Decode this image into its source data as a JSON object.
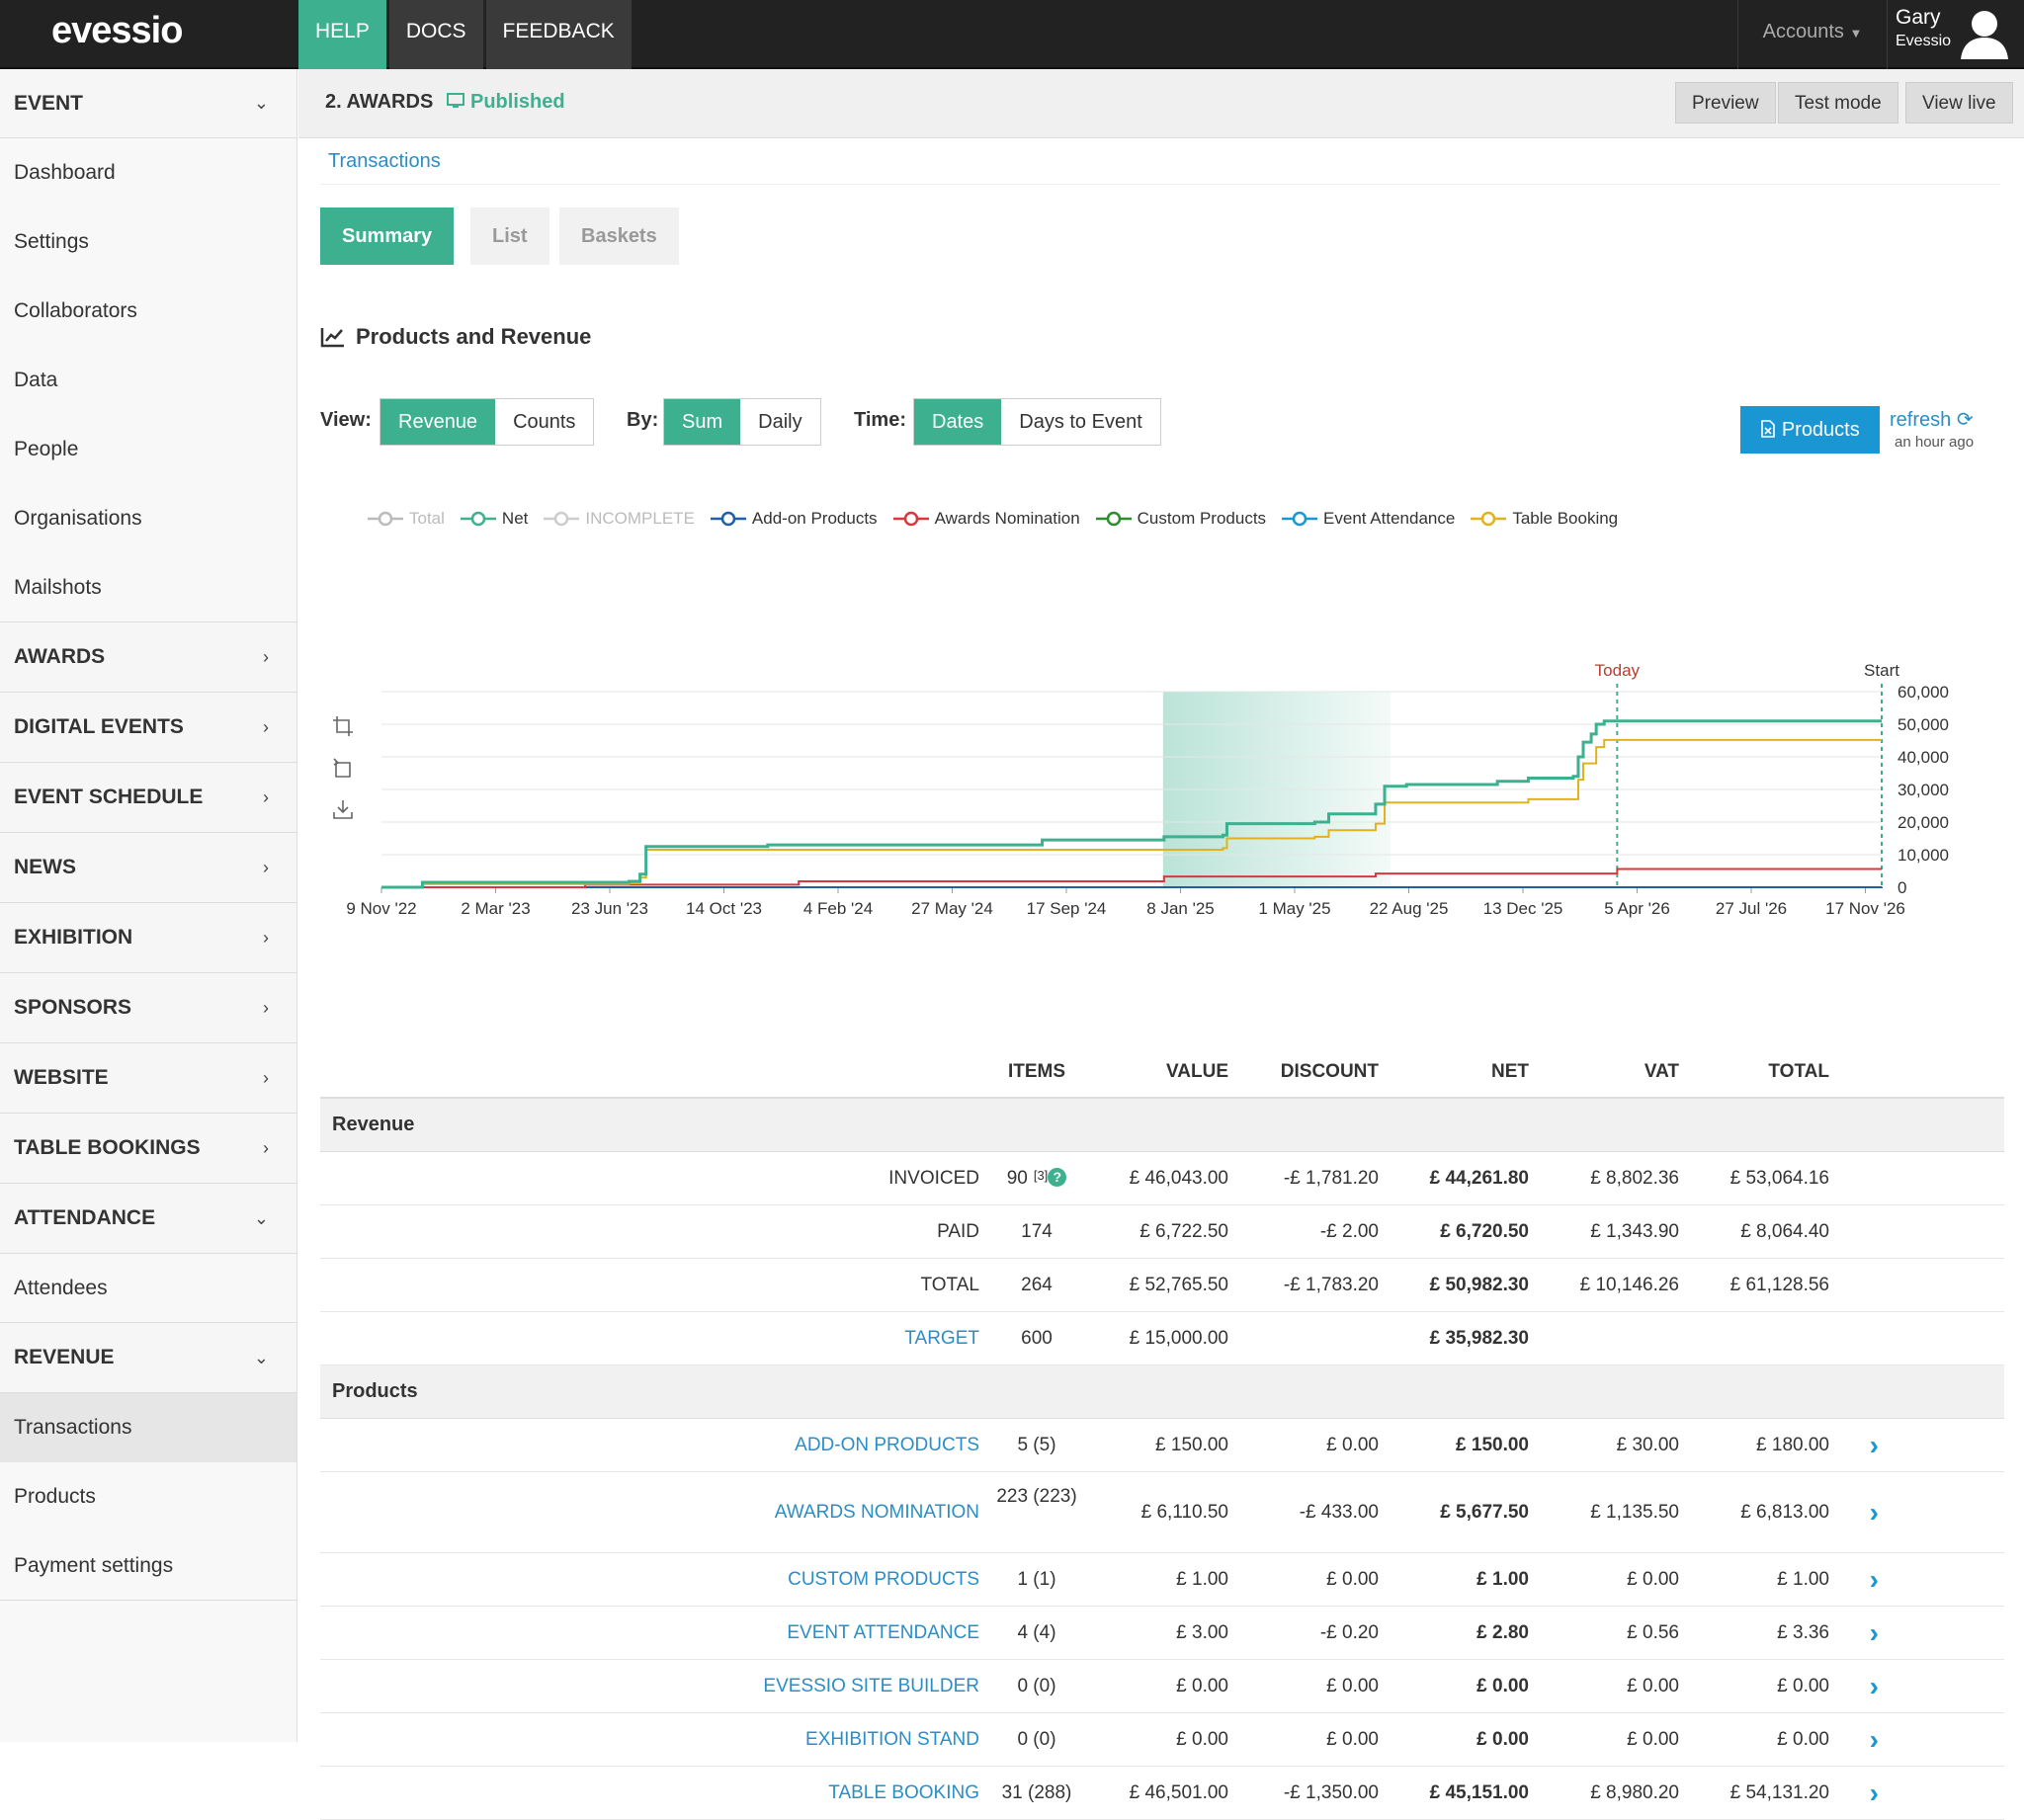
{
  "topbar": {
    "logo": "evessio",
    "nav": [
      "HELP",
      "DOCS",
      "FEEDBACK"
    ],
    "accounts": "Accounts",
    "user_name": "Gary",
    "user_org": "Evessio"
  },
  "sidebar": {
    "event": "EVENT",
    "event_items": [
      "Dashboard",
      "Settings",
      "Collaborators",
      "Data",
      "People",
      "Organisations",
      "Mailshots"
    ],
    "sections": [
      "AWARDS",
      "DIGITAL EVENTS",
      "EVENT SCHEDULE",
      "NEWS",
      "EXHIBITION",
      "SPONSORS",
      "WEBSITE",
      "TABLE BOOKINGS"
    ],
    "attendance": "ATTENDANCE",
    "attendance_items": [
      "Attendees"
    ],
    "revenue": "REVENUE",
    "revenue_items": [
      "Transactions",
      "Products",
      "Payment settings"
    ]
  },
  "page": {
    "title": "2. AWARDS",
    "status": "Published",
    "buttons": [
      "Preview",
      "Test mode",
      "View live"
    ],
    "breadcrumb": "Transactions",
    "tabs": [
      "Summary",
      "List",
      "Baskets"
    ]
  },
  "section_title": "Products and Revenue",
  "controls": {
    "view_label": "View:",
    "view_options": [
      "Revenue",
      "Counts"
    ],
    "by_label": "By:",
    "by_options": [
      "Sum",
      "Daily"
    ],
    "time_label": "Time:",
    "time_options": [
      "Dates",
      "Days to Event"
    ],
    "products_button": "Products",
    "refresh": "refresh",
    "refreshed": "an hour ago"
  },
  "chart_data": {
    "type": "line",
    "x_ticks": [
      "9 Nov '22",
      "2 Mar '23",
      "23 Jun '23",
      "14 Oct '23",
      "4 Feb '24",
      "27 May '24",
      "17 Sep '24",
      "8 Jan '25",
      "1 May '25",
      "22 Aug '25",
      "13 Dec '25",
      "5 Apr '26",
      "27 Jul '26",
      "17 Nov '26"
    ],
    "y_ticks": [
      "60,000",
      "50,000",
      "40,000",
      "30,000",
      "20,000",
      "10,000",
      "0"
    ],
    "ylim": [
      0,
      60000
    ],
    "xlim": [
      "2022-11-09",
      "2026-12-21"
    ],
    "markers": [
      {
        "label": "Today",
        "date": "2026-03-31",
        "color": "#c0392b"
      },
      {
        "label": "Start",
        "date": "2026-12-21",
        "color": "#333333"
      }
    ],
    "highlight": {
      "from": "2024-12-31",
      "to": "2025-08-16"
    },
    "legend": [
      {
        "name": "Total",
        "color": "#bbbbbb",
        "dim": true
      },
      {
        "name": "Net",
        "color": "#3cb08f",
        "dim": false
      },
      {
        "name": "INCOMPLETE",
        "color": "#cccccc",
        "dim": true
      },
      {
        "name": "Add-on Products",
        "color": "#1f5fa8",
        "dim": false
      },
      {
        "name": "Awards Nomination",
        "color": "#d9363e",
        "dim": false
      },
      {
        "name": "Custom Products",
        "color": "#2e8b2e",
        "dim": false
      },
      {
        "name": "Event Attendance",
        "color": "#1a96d2",
        "dim": false
      },
      {
        "name": "Table Booking",
        "color": "#e0b21d",
        "dim": false
      }
    ],
    "series": [
      {
        "name": "Net",
        "color": "#3cb08f",
        "points": [
          [
            "2022-11-09",
            0
          ],
          [
            "2022-12-20",
            1500
          ],
          [
            "2023-07-15",
            1800
          ],
          [
            "2023-07-26",
            4000
          ],
          [
            "2023-08-01",
            12500
          ],
          [
            "2023-12-01",
            13000
          ],
          [
            "2024-09-01",
            14500
          ],
          [
            "2025-01-01",
            15500
          ],
          [
            "2025-03-01",
            16000
          ],
          [
            "2025-03-05",
            19500
          ],
          [
            "2025-06-01",
            20000
          ],
          [
            "2025-06-15",
            22500
          ],
          [
            "2025-08-01",
            25500
          ],
          [
            "2025-08-10",
            31000
          ],
          [
            "2025-09-01",
            31500
          ],
          [
            "2025-12-01",
            32500
          ],
          [
            "2026-01-01",
            33500
          ],
          [
            "2026-02-15",
            34000
          ],
          [
            "2026-02-20",
            40000
          ],
          [
            "2026-02-25",
            44500
          ],
          [
            "2026-03-05",
            47000
          ],
          [
            "2026-03-10",
            50000
          ],
          [
            "2026-03-18",
            51000
          ],
          [
            "2026-12-21",
            51000
          ]
        ]
      },
      {
        "name": "Table Booking",
        "color": "#e0b21d",
        "points": [
          [
            "2022-11-09",
            0
          ],
          [
            "2022-12-20",
            1000
          ],
          [
            "2023-07-15",
            1200
          ],
          [
            "2023-07-26",
            3000
          ],
          [
            "2023-08-01",
            11500
          ],
          [
            "2025-03-01",
            12000
          ],
          [
            "2025-03-05",
            15000
          ],
          [
            "2025-06-01",
            15500
          ],
          [
            "2025-06-15",
            17500
          ],
          [
            "2025-08-01",
            19500
          ],
          [
            "2025-08-10",
            26000
          ],
          [
            "2026-01-01",
            27000
          ],
          [
            "2026-02-20",
            33000
          ],
          [
            "2026-02-25",
            38000
          ],
          [
            "2026-03-10",
            43000
          ],
          [
            "2026-03-18",
            45200
          ],
          [
            "2026-12-21",
            45200
          ]
        ]
      },
      {
        "name": "Awards Nomination",
        "color": "#d9363e",
        "points": [
          [
            "2022-11-09",
            0
          ],
          [
            "2023-06-01",
            800
          ],
          [
            "2024-01-01",
            1800
          ],
          [
            "2025-01-01",
            3300
          ],
          [
            "2025-08-01",
            4200
          ],
          [
            "2026-03-31",
            5600
          ],
          [
            "2026-12-21",
            5600
          ]
        ]
      },
      {
        "name": "Add-on Products",
        "color": "#1f5fa8",
        "points": [
          [
            "2022-11-09",
            0
          ],
          [
            "2026-12-21",
            150
          ]
        ]
      }
    ]
  },
  "table": {
    "headers": [
      "ITEMS",
      "VALUE",
      "DISCOUNT",
      "NET",
      "VAT",
      "TOTAL"
    ],
    "revenue_label": "Revenue",
    "revenue_rows": [
      {
        "label": "INVOICED",
        "items": "90",
        "sup": "[3]",
        "help": "?",
        "value": "£ 46,043.00",
        "discount": "-£ 1,781.20",
        "net": "£ 44,261.80",
        "vat": "£ 8,802.36",
        "total": "£ 53,064.16",
        "link": false
      },
      {
        "label": "PAID",
        "items": "174",
        "value": "£ 6,722.50",
        "discount": "-£ 2.00",
        "net": "£ 6,720.50",
        "vat": "£ 1,343.90",
        "total": "£ 8,064.40",
        "link": false
      },
      {
        "label": "TOTAL",
        "items": "264",
        "value": "£ 52,765.50",
        "discount": "-£ 1,783.20",
        "net": "£ 50,982.30",
        "vat": "£ 10,146.26",
        "total": "£ 61,128.56",
        "link": false
      },
      {
        "label": "TARGET",
        "items": "600",
        "value": "£ 15,000.00",
        "discount": "",
        "net": "£ 35,982.30",
        "vat": "",
        "total": "",
        "link": true
      }
    ],
    "products_label": "Products",
    "product_rows": [
      {
        "label": "ADD-ON PRODUCTS",
        "items": "5 (5)",
        "value": "£ 150.00",
        "discount": "£ 0.00",
        "net": "£ 150.00",
        "vat": "£ 30.00",
        "total": "£ 180.00"
      },
      {
        "label": "AWARDS NOMINATION",
        "items": "223 (223)",
        "value": "£ 6,110.50",
        "discount": "-£ 433.00",
        "net": "£ 5,677.50",
        "vat": "£ 1,135.50",
        "total": "£ 6,813.00"
      },
      {
        "label": "CUSTOM PRODUCTS",
        "items": "1 (1)",
        "value": "£ 1.00",
        "discount": "£ 0.00",
        "net": "£ 1.00",
        "vat": "£ 0.00",
        "total": "£ 1.00"
      },
      {
        "label": "EVENT ATTENDANCE",
        "items": "4 (4)",
        "value": "£ 3.00",
        "discount": "-£ 0.20",
        "net": "£ 2.80",
        "vat": "£ 0.56",
        "total": "£ 3.36"
      },
      {
        "label": "EVESSIO SITE BUILDER",
        "items": "0 (0)",
        "value": "£ 0.00",
        "discount": "£ 0.00",
        "net": "£ 0.00",
        "vat": "£ 0.00",
        "total": "£ 0.00"
      },
      {
        "label": "EXHIBITION STAND",
        "items": "0 (0)",
        "value": "£ 0.00",
        "discount": "£ 0.00",
        "net": "£ 0.00",
        "vat": "£ 0.00",
        "total": "£ 0.00"
      },
      {
        "label": "TABLE BOOKING",
        "items": "31 (288)",
        "value": "£ 46,501.00",
        "discount": "-£ 1,350.00",
        "net": "£ 45,151.00",
        "vat": "£ 8,980.20",
        "total": "£ 54,131.20"
      }
    ]
  }
}
